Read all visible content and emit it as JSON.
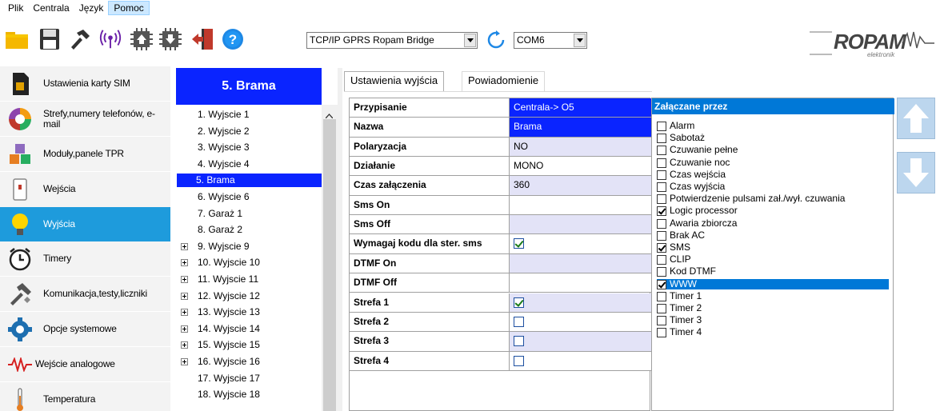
{
  "menu": {
    "items": [
      "Plik",
      "Centrala",
      "Język",
      "Pomoc"
    ]
  },
  "toolbar": {
    "connection_select": "TCP/IP GPRS Ropam Bridge",
    "port_select": "COM6",
    "icons": [
      "folder-open-icon",
      "save-icon",
      "hammer-icon",
      "antenna-icon",
      "chip-upload-icon",
      "chip-download-icon",
      "exit-door-icon",
      "help-icon",
      "refresh-icon"
    ]
  },
  "sidebar": {
    "items": [
      {
        "label": "Ustawienia karty SIM",
        "icon": "sim-card-icon"
      },
      {
        "label": "Strefy,numery telefonów, e-mail",
        "icon": "pie-chart-icon"
      },
      {
        "label": "Moduły,panele TPR",
        "icon": "cubes-icon"
      },
      {
        "label": "Wejścia",
        "icon": "door-sensor-icon"
      },
      {
        "label": "Wyjścia",
        "icon": "lightbulb-icon"
      },
      {
        "label": "Timery",
        "icon": "alarm-clock-icon"
      },
      {
        "label": "Komunikacja,testy,liczniki",
        "icon": "tools-icon"
      },
      {
        "label": "Opcje systemowe",
        "icon": "gear-icon"
      },
      {
        "label": "Wejście analogowe",
        "icon": "waveform-icon"
      },
      {
        "label": "Temperatura",
        "icon": "thermometer-icon"
      }
    ],
    "active_index": 4
  },
  "outputs_header": "5. Brama",
  "outputs": [
    {
      "label": "1. Wyjscie 1",
      "expand": false
    },
    {
      "label": "2. Wyjscie 2",
      "expand": false
    },
    {
      "label": "3. Wyjscie 3",
      "expand": false
    },
    {
      "label": "4. Wyjscie 4",
      "expand": false
    },
    {
      "label": "5. Brama",
      "expand": false
    },
    {
      "label": "6. Wyjscie 6",
      "expand": false
    },
    {
      "label": "7. Garaż 1",
      "expand": false
    },
    {
      "label": "8. Garaż 2",
      "expand": false
    },
    {
      "label": "9. Wyjscie 9",
      "expand": true
    },
    {
      "label": "10. Wyjscie 10",
      "expand": true
    },
    {
      "label": "11. Wyjscie 11",
      "expand": true
    },
    {
      "label": "12. Wyjscie 12",
      "expand": true
    },
    {
      "label": "13. Wyjscie 13",
      "expand": true
    },
    {
      "label": "14. Wyjscie 14",
      "expand": true
    },
    {
      "label": "15. Wyjscie 15",
      "expand": true
    },
    {
      "label": "16. Wyjscie 16",
      "expand": true
    },
    {
      "label": "17. Wyjscie 17",
      "expand": false
    },
    {
      "label": "18. Wyjscie 18",
      "expand": false
    }
  ],
  "outputs_selected": 4,
  "tabs": [
    "Ustawienia wyjścia",
    "Powiadomienie"
  ],
  "properties": [
    {
      "key": "Przypisanie",
      "value": "Centrala-> O5",
      "kind": "text",
      "selected": true
    },
    {
      "key": "Nazwa",
      "value": "Brama",
      "kind": "text",
      "selected": true
    },
    {
      "key": "Polaryzacja",
      "value": "NO",
      "kind": "text"
    },
    {
      "key": "Działanie",
      "value": "MONO",
      "kind": "text",
      "white": true
    },
    {
      "key": "Czas załączenia",
      "value": "360",
      "kind": "text"
    },
    {
      "key": "Sms On",
      "value": "",
      "kind": "text",
      "white": true
    },
    {
      "key": "Sms Off",
      "value": "",
      "kind": "text"
    },
    {
      "key": "Wymagaj kodu dla ster. sms",
      "value": "",
      "kind": "check",
      "checked": true,
      "white": true
    },
    {
      "key": "DTMF On",
      "value": "",
      "kind": "text"
    },
    {
      "key": "DTMF Off",
      "value": "",
      "kind": "text",
      "white": true
    },
    {
      "key": "Strefa 1",
      "value": "",
      "kind": "check",
      "checked": true
    },
    {
      "key": "Strefa 2",
      "value": "",
      "kind": "check",
      "checked": false,
      "white": true
    },
    {
      "key": "Strefa 3",
      "value": "",
      "kind": "check",
      "checked": false
    },
    {
      "key": "Strefa 4",
      "value": "",
      "kind": "check",
      "checked": false,
      "white": true
    }
  ],
  "triggers_header": "Załączane przez",
  "triggers": [
    {
      "label": "Alarm",
      "checked": false
    },
    {
      "label": "Sabotaż",
      "checked": false
    },
    {
      "label": "Czuwanie pełne",
      "checked": false
    },
    {
      "label": "Czuwanie noc",
      "checked": false
    },
    {
      "label": "Czas wejścia",
      "checked": false
    },
    {
      "label": "Czas wyjścia",
      "checked": false
    },
    {
      "label": "Potwierdzenie pulsami zał./wył. czuwania",
      "checked": false
    },
    {
      "label": "Logic processor",
      "checked": true
    },
    {
      "label": "Awaria zbiorcza",
      "checked": false
    },
    {
      "label": "Brak AC",
      "checked": false
    },
    {
      "label": "SMS",
      "checked": true
    },
    {
      "label": "CLIP",
      "checked": false
    },
    {
      "label": "Kod DTMF",
      "checked": false
    },
    {
      "label": "WWW",
      "checked": true
    },
    {
      "label": "Timer 1",
      "checked": false
    },
    {
      "label": "Timer 2",
      "checked": false
    },
    {
      "label": "Timer 3",
      "checked": false
    },
    {
      "label": "Timer 4",
      "checked": false
    }
  ],
  "triggers_selected": 13,
  "brand": {
    "name": "ROPAM",
    "sub": "elektronik"
  },
  "colors": {
    "accent": "#1e9bdc",
    "selection": "#0a24ff",
    "header": "#0078d7"
  }
}
